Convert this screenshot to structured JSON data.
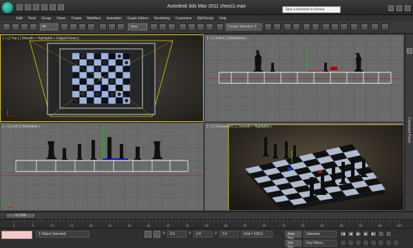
{
  "titlebar": {
    "title": "Autodesk 3ds Max  2011      chess1.max",
    "search_placeholder": "Type a keyword or phrase"
  },
  "menu": [
    "Edit",
    "Tools",
    "Group",
    "Views",
    "Create",
    "Modifiers",
    "Animation",
    "Graph Editors",
    "Rendering",
    "Customize",
    "MAXScript",
    "Help"
  ],
  "toolbar": {
    "filter_select": "All",
    "coord_select": "View",
    "named_selection": "Create Selection S"
  },
  "viewports": {
    "top": "[ + ] [ Top ] [ Smooth + Highlights + Edged Faces ]",
    "front": "[ + ] [ Front ] [ Wireframe ]",
    "left": "[ + ] [ Left ] [ Wireframe ]",
    "camera": "[ + ] [ Camera001 ] [ Smooth + Highlights ]"
  },
  "command_panel_label": "Command Panel",
  "timeline": {
    "current": "0 / 100",
    "ticks": [
      "0",
      "5",
      "10",
      "15",
      "20",
      "25",
      "30",
      "35",
      "40",
      "45",
      "50",
      "55",
      "60",
      "65",
      "70",
      "75",
      "80",
      "85",
      "90",
      "95",
      "100"
    ]
  },
  "status": {
    "selection_text": "1 Object Selected",
    "x_label": "X:",
    "x_value": "0.0",
    "y_label": "Y:",
    "y_value": "0.0",
    "z_label": "Z:",
    "z_value": "0.0",
    "grid_text": "Grid = 100.0",
    "autokey_label": "Auto Key",
    "autokey_select": "Selected",
    "setkey_label": "Set Key",
    "key_filters_label": "Key Filters..."
  },
  "colors": {
    "selected_border": "#e5d200",
    "grid_line": "#555555",
    "axis_red": "#c01010",
    "axis_green": "#10c010",
    "axis_blue": "#1010c0"
  }
}
